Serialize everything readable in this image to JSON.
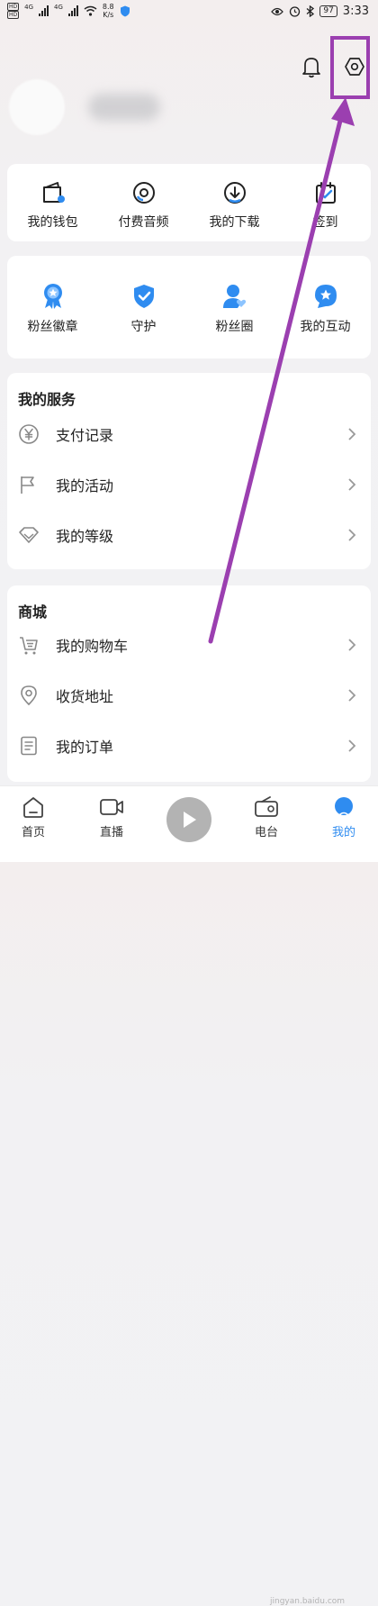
{
  "status_bar": {
    "net_labels": [
      "HD",
      "HD"
    ],
    "net_type": "4G",
    "speed_value": "8.8",
    "speed_unit": "K/s",
    "battery": "97",
    "time": "3:33"
  },
  "quick_actions": [
    {
      "label": "我的钱包",
      "icon": "wallet-icon"
    },
    {
      "label": "付费音频",
      "icon": "disc-icon"
    },
    {
      "label": "我的下载",
      "icon": "download-icon"
    },
    {
      "label": "签到",
      "icon": "calendar-checkin-icon"
    }
  ],
  "fan_actions": [
    {
      "label": "粉丝徽章",
      "icon": "badge-icon"
    },
    {
      "label": "守护",
      "icon": "shield-icon"
    },
    {
      "label": "粉丝圈",
      "icon": "fan-circle-icon"
    },
    {
      "label": "我的互动",
      "icon": "interaction-icon"
    }
  ],
  "services": {
    "title": "我的服务",
    "items": [
      {
        "label": "支付记录",
        "icon": "yuan-icon"
      },
      {
        "label": "我的活动",
        "icon": "flag-icon"
      },
      {
        "label": "我的等级",
        "icon": "diamond-icon"
      }
    ]
  },
  "shop": {
    "title": "商城",
    "items": [
      {
        "label": "我的购物车",
        "icon": "cart-icon"
      },
      {
        "label": "收货地址",
        "icon": "location-icon"
      },
      {
        "label": "我的订单",
        "icon": "order-icon"
      }
    ]
  },
  "tabbar": {
    "items": [
      {
        "label": "首页",
        "icon": "home-icon"
      },
      {
        "label": "直播",
        "icon": "live-icon"
      },
      {
        "label": "电台",
        "icon": "radio-icon"
      },
      {
        "label": "我的",
        "icon": "profile-icon"
      }
    ],
    "active_index": 3
  },
  "colors": {
    "accent": "#2f8cf0",
    "annotation": "#9b3fb0"
  },
  "watermark": "jingyan.baidu.com"
}
